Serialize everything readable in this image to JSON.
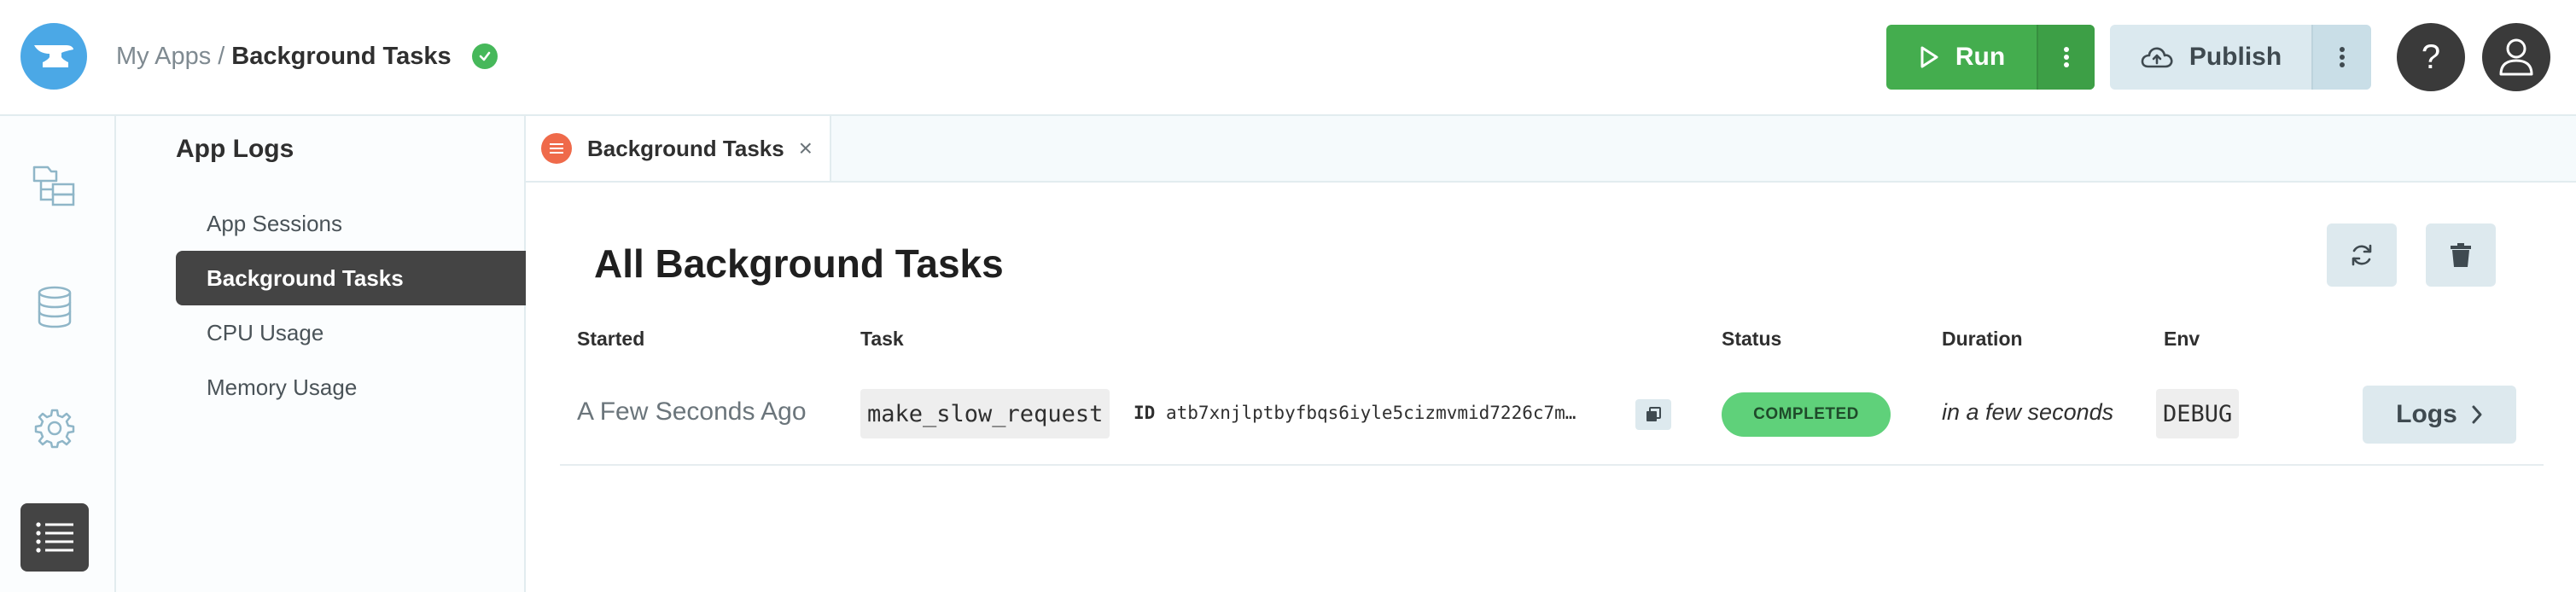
{
  "header": {
    "breadcrumb_parent": "My Apps",
    "breadcrumb_separator": "/",
    "breadcrumb_current": "Background Tasks",
    "run_label": "Run",
    "publish_label": "Publish",
    "help_label": "?"
  },
  "rail": {
    "items": [
      {
        "icon": "app-tree-icon"
      },
      {
        "icon": "database-icon"
      },
      {
        "icon": "gear-icon"
      },
      {
        "icon": "list-icon",
        "active": true
      }
    ]
  },
  "logs_panel": {
    "title": "App Logs",
    "items": [
      {
        "label": "App Sessions"
      },
      {
        "label": "Background Tasks",
        "active": true
      },
      {
        "label": "CPU Usage"
      },
      {
        "label": "Memory Usage"
      }
    ]
  },
  "tabs": [
    {
      "label": "Background Tasks",
      "close": "×"
    }
  ],
  "main": {
    "title": "All Background Tasks",
    "columns": [
      "Started",
      "Task",
      "Status",
      "Duration",
      "Env"
    ],
    "rows": [
      {
        "started": "A Few Seconds Ago",
        "task_name": "make_slow_request",
        "id_label": "ID",
        "task_id": "atb7xnjlptbyfbqs6iyle5cizmvmid7226c7m…",
        "status": "COMPLETED",
        "duration": "in a few seconds",
        "env": "DEBUG",
        "logs_label": "Logs"
      }
    ]
  },
  "colors": {
    "run_green": "#44ad4e",
    "status_green": "#5fd17a",
    "logo_blue": "#4ba8e6",
    "tab_icon_orange": "#ef6a4a",
    "active_dark": "#444444"
  }
}
